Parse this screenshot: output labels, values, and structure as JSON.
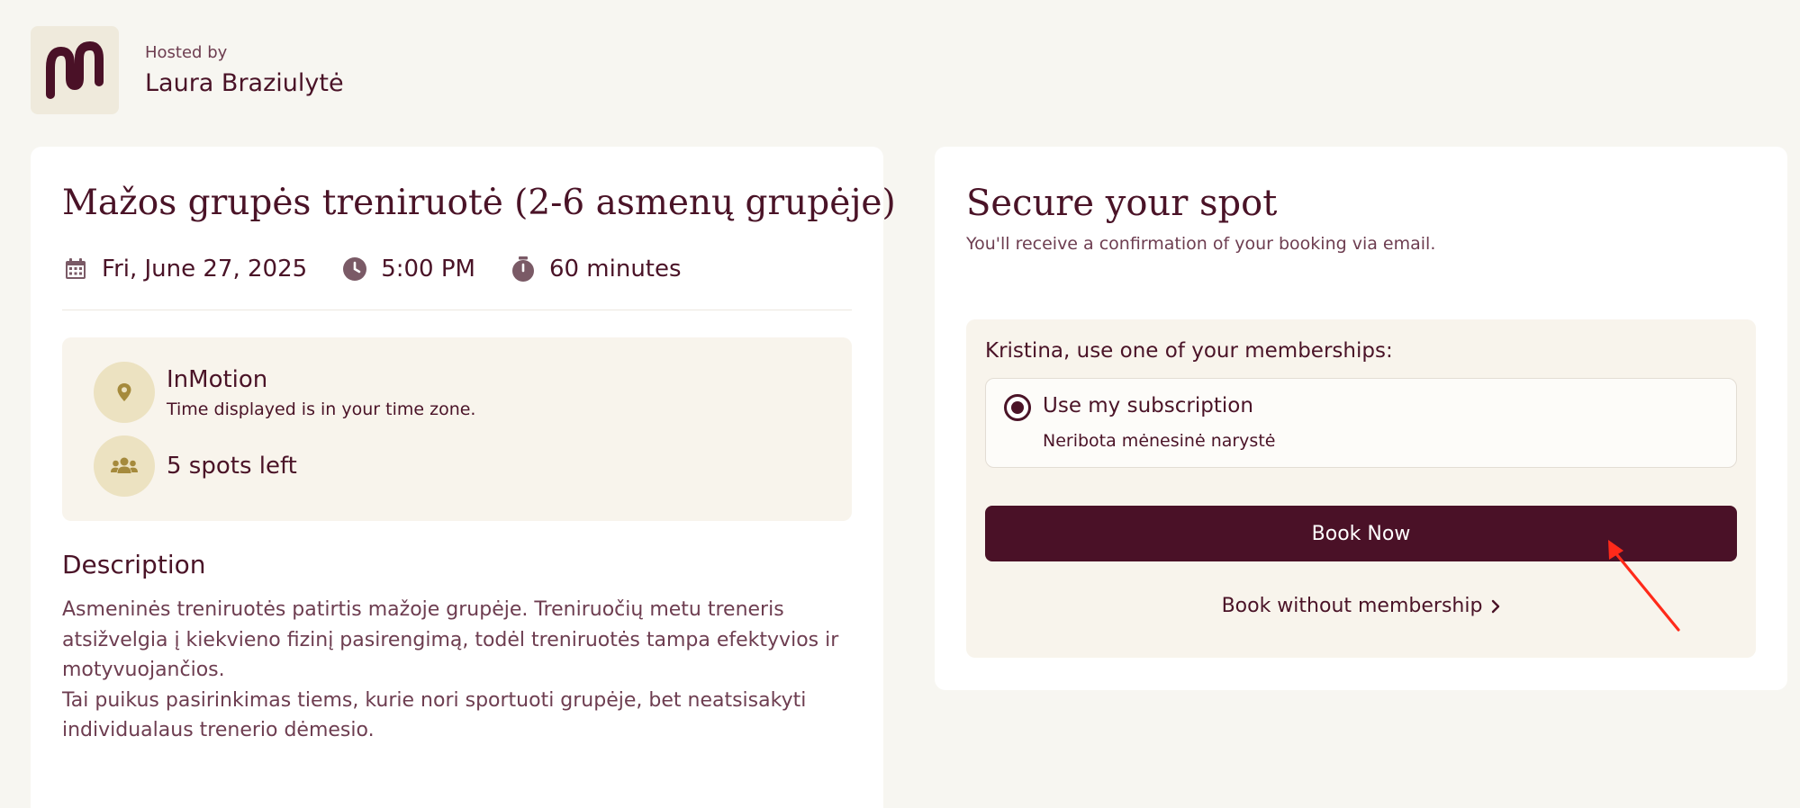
{
  "host": {
    "label": "Hosted by",
    "name": "Laura Braziulytė"
  },
  "event": {
    "title": "Mažos grupės treniruotė (2-6 asmenų grupėje)",
    "date": "Fri, June 27, 2025",
    "time": "5:00 PM",
    "duration": "60 minutes",
    "location_name": "InMotion",
    "location_note": "Time displayed is in your time zone.",
    "spots": "5 spots left"
  },
  "description": {
    "heading": "Description",
    "paragraph1": "Asmeninės treniruotės patirtis mažoje grupėje. Treniruočių metu treneris atsižvelgia į kiekvieno fizinį pasirengimą, todėl treniruotės tampa efektyvios ir motyvuojančios.",
    "paragraph2": "Tai puikus pasirinkimas tiems, kurie nori sportuoti grupėje, bet neatsisakyti individualaus trenerio dėmesio."
  },
  "booking": {
    "title": "Secure your spot",
    "subtitle": "You'll receive a confirmation of your booking via email.",
    "membership_prompt": "Kristina, use one of your memberships:",
    "option_title": "Use my subscription",
    "option_subtitle": "Neribota mėnesinė narystė",
    "option_selected": true,
    "book_button": "Book Now",
    "book_without": "Book without membership"
  },
  "colors": {
    "brand": "#4a1127",
    "accent_gold": "#a58a3c",
    "icon_circle": "#ece2c1",
    "panel": "#f8f4ec",
    "annotation_arrow": "#ff2a1a"
  },
  "icons": {
    "logo": "wave-m-logo",
    "date": "calendar-icon",
    "time": "clock-icon",
    "duration": "stopwatch-icon",
    "location": "map-pin-icon",
    "spots": "users-icon",
    "book_without": "chevron-right-icon"
  }
}
